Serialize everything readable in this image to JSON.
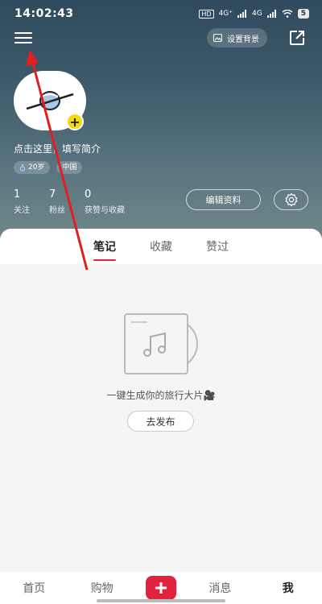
{
  "status_bar": {
    "time": "14:02:43",
    "signal1": "4G⁺",
    "signal2": "4G",
    "battery": "5"
  },
  "header": {
    "set_background_label": "设置背景"
  },
  "profile": {
    "bio_prompt": "点击这里，填写简介",
    "tags": [
      {
        "icon": "gender-icon",
        "label": "20岁"
      },
      {
        "label": "中国"
      }
    ],
    "stats": [
      {
        "value": "1",
        "label": "关注"
      },
      {
        "value": "7",
        "label": "粉丝"
      },
      {
        "value": "0",
        "label": "获赞与收藏"
      }
    ],
    "edit_button_label": "编辑资料"
  },
  "tabs": [
    {
      "label": "笔记",
      "active": true
    },
    {
      "label": "收藏",
      "active": false
    },
    {
      "label": "赞过",
      "active": false
    }
  ],
  "empty_state": {
    "message": "一键生成你的旅行大片🎥",
    "button_label": "去发布"
  },
  "bottom_nav": [
    {
      "label": "首页",
      "active": false
    },
    {
      "label": "购物",
      "active": false
    },
    {
      "label": "消息",
      "active": false
    },
    {
      "label": "我",
      "active": true
    }
  ],
  "colors": {
    "accent": "#e2233d",
    "header_top": "#2f4a5c",
    "header_bottom": "#6f8889",
    "badge": "#f5d90a"
  }
}
